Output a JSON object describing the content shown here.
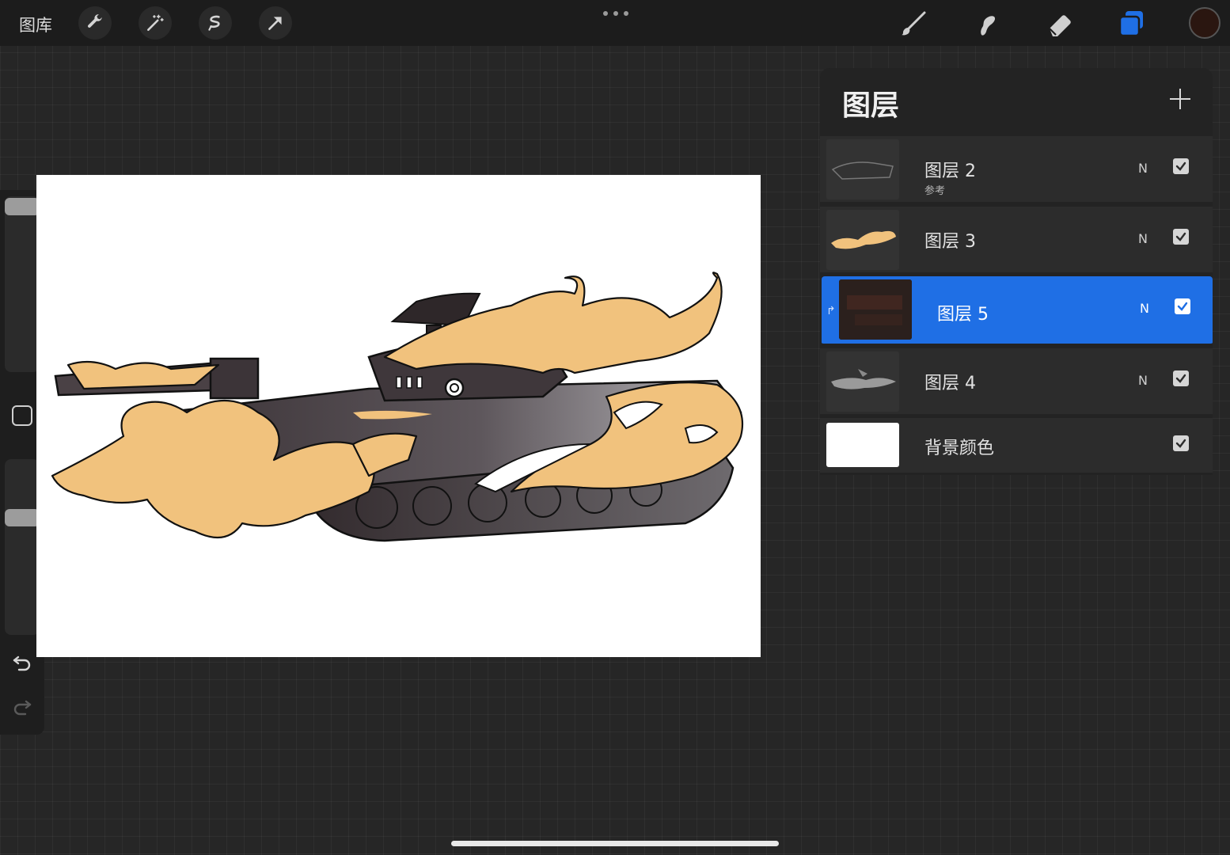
{
  "topbar": {
    "gallery_label": "图库",
    "tools_left": [
      "wrench-icon",
      "magic-wand-icon",
      "selection-icon",
      "transform-icon"
    ],
    "tools_right": [
      "brush-icon",
      "smudge-icon",
      "eraser-icon",
      "layers-icon"
    ],
    "current_color": "#2a1610"
  },
  "layers_panel": {
    "title": "图层",
    "layers": [
      {
        "name": "图层 2",
        "sub": "参考",
        "blend": "N",
        "visible": true,
        "active": false
      },
      {
        "name": "图层 3",
        "sub": "",
        "blend": "N",
        "visible": true,
        "active": false
      },
      {
        "name": "图层 5",
        "sub": "",
        "blend": "N",
        "visible": true,
        "active": true,
        "clipped": true
      },
      {
        "name": "图层 4",
        "sub": "",
        "blend": "N",
        "visible": true,
        "active": false
      }
    ],
    "background": {
      "name": "背景颜色",
      "visible": true
    }
  },
  "colors": {
    "accent": "#1f6fe5",
    "flame": "#f1c27d",
    "tank_dark": "#4a4145"
  }
}
